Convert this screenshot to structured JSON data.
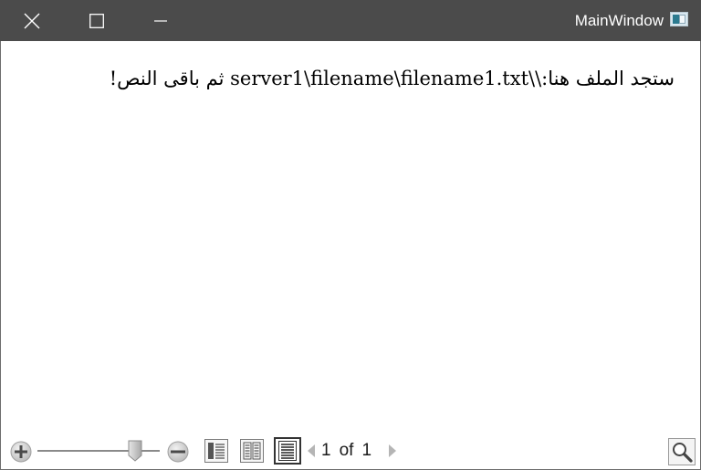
{
  "window": {
    "title": "MainWindow",
    "controls": {
      "close_icon": "close-icon",
      "maximize_icon": "maximize-icon",
      "minimize_icon": "minimize-icon"
    },
    "colors": {
      "titlebar": "#4b4b4b",
      "title_text": "#ffffff",
      "content_bg": "#ffffff"
    }
  },
  "document": {
    "paragraph": "ستجد الملف هنا:\\\\server1\\filename\\filename1.txt ثم باقى النص!"
  },
  "toolbar": {
    "zoom_in_icon": "zoom-in-icon",
    "zoom_out_icon": "zoom-out-icon",
    "zoom_level_fraction": 0.8,
    "view_modes": [
      "single-page-view-icon",
      "two-page-view-icon",
      "scroll-view-icon"
    ],
    "active_view_mode": "scroll-view-icon",
    "page": {
      "current": "1",
      "of_label": "of",
      "total": "1"
    },
    "find_icon": "search-icon"
  }
}
